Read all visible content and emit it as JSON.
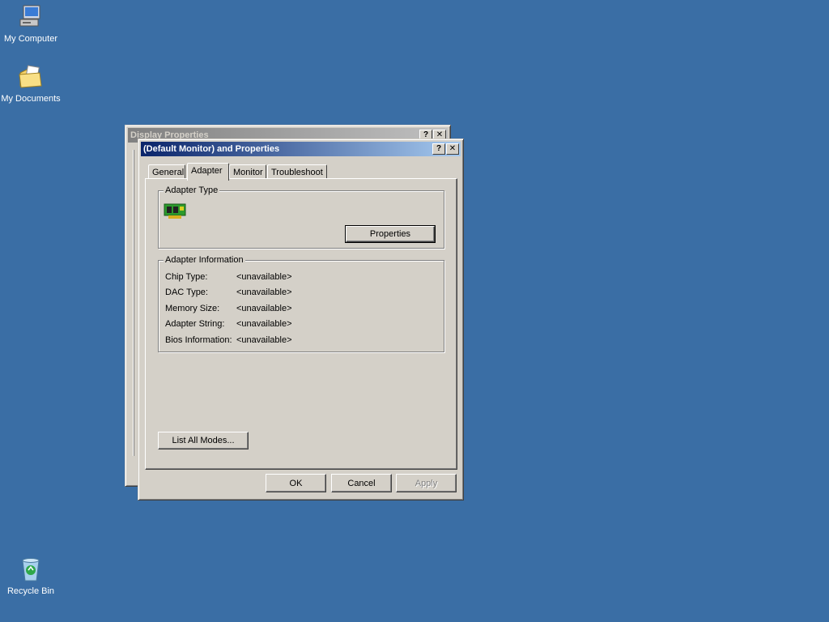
{
  "desktop": {
    "icons": [
      {
        "label": "My Computer"
      },
      {
        "label": "My Documents"
      },
      {
        "label": "Recycle Bin"
      }
    ]
  },
  "back_window": {
    "title": "Display Properties"
  },
  "dialog": {
    "title": "(Default Monitor) and  Properties",
    "help_btn": "?",
    "close_btn": "✕",
    "tabs": [
      {
        "label": "General"
      },
      {
        "label": "Adapter"
      },
      {
        "label": "Monitor"
      },
      {
        "label": "Troubleshoot"
      }
    ],
    "adapter_type": {
      "legend": "Adapter Type",
      "properties_button": "Properties"
    },
    "adapter_info": {
      "legend": "Adapter Information",
      "rows": [
        {
          "key": "Chip Type:",
          "value": "<unavailable>"
        },
        {
          "key": "DAC Type:",
          "value": "<unavailable>"
        },
        {
          "key": "Memory Size:",
          "value": "<unavailable>"
        },
        {
          "key": "Adapter String:",
          "value": "<unavailable>"
        },
        {
          "key": "Bios Information:",
          "value": "<unavailable>"
        }
      ]
    },
    "list_modes_button": "List All Modes...",
    "ok_button": "OK",
    "cancel_button": "Cancel",
    "apply_button": "Apply"
  },
  "colors": {
    "desktop": "#3a6ea5",
    "face": "#d4d0c8",
    "title_active": "#0a246a"
  }
}
